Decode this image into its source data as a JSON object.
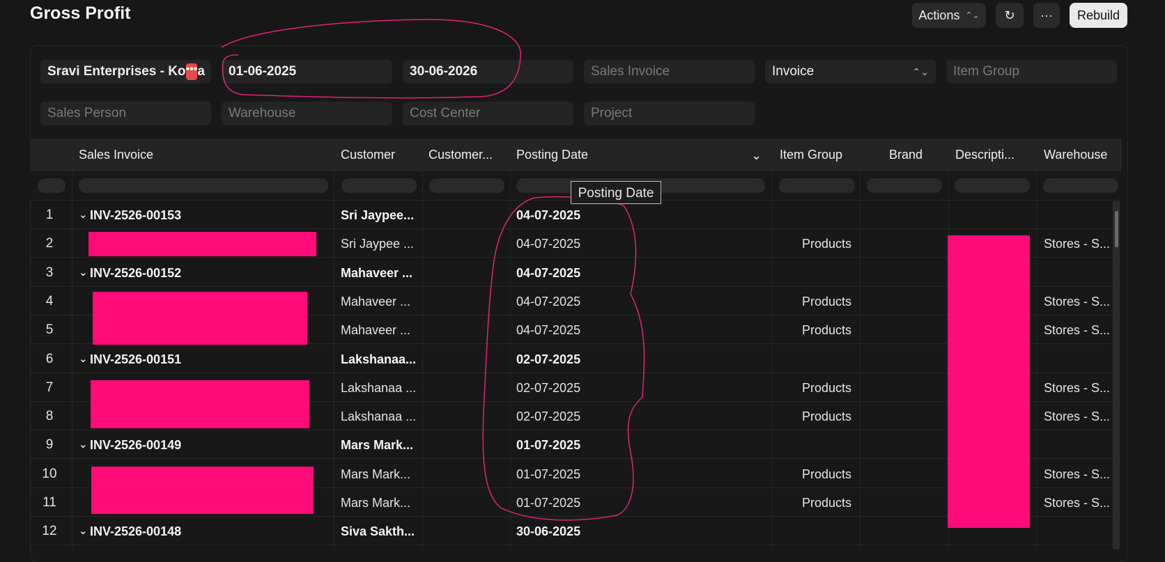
{
  "page": {
    "title": "Gross Profit"
  },
  "toolbar": {
    "actions_label": "Actions",
    "actions_arrow": "⌃⌄",
    "refresh_icon": "↻",
    "more_label": "···",
    "rebuild_label": "Rebuild"
  },
  "filters": {
    "company": "Sravi Enterprises - Ko",
    "company_tail": "a",
    "from_date": "01-06-2025",
    "to_date": "30-06-2026",
    "sales_invoice_placeholder": "Sales Invoice",
    "group_by": "Invoice",
    "item_group_placeholder": "Item Group",
    "sales_person_placeholder": "Sales Person",
    "warehouse_placeholder": "Warehouse",
    "cost_center_placeholder": "Cost Center",
    "project_placeholder": "Project"
  },
  "table": {
    "headers": {
      "sales_invoice": "Sales Invoice",
      "customer": "Customer",
      "customer_group": "Customer...",
      "posting_date": "Posting Date",
      "item_group": "Item Group",
      "brand": "Brand",
      "description": "Descripti...",
      "warehouse": "Warehouse"
    },
    "rows": [
      {
        "n": "1",
        "invoice": "INV-2526-00153",
        "customer": "Sri Jaypee...",
        "date": "04-07-2025",
        "item_group": "",
        "warehouse": ""
      },
      {
        "n": "2",
        "invoice": "",
        "customer": "Sri Jaypee ...",
        "date": "04-07-2025",
        "item_group": "Products",
        "warehouse": "Stores - S..."
      },
      {
        "n": "3",
        "invoice": "INV-2526-00152",
        "customer": "Mahaveer ...",
        "date": "04-07-2025",
        "item_group": "",
        "warehouse": ""
      },
      {
        "n": "4",
        "invoice": "",
        "customer": "Mahaveer ...",
        "date": "04-07-2025",
        "item_group": "Products",
        "warehouse": "Stores - S..."
      },
      {
        "n": "5",
        "invoice": "",
        "customer": "Mahaveer ...",
        "date": "04-07-2025",
        "item_group": "Products",
        "warehouse": "Stores - S..."
      },
      {
        "n": "6",
        "invoice": "INV-2526-00151",
        "customer": "Lakshanaa...",
        "date": "02-07-2025",
        "item_group": "",
        "warehouse": ""
      },
      {
        "n": "7",
        "invoice": "",
        "customer": "Lakshanaa ...",
        "date": "02-07-2025",
        "item_group": "Products",
        "warehouse": "Stores - S..."
      },
      {
        "n": "8",
        "invoice": "",
        "customer": "Lakshanaa ...",
        "date": "02-07-2025",
        "item_group": "Products",
        "warehouse": "Stores - S..."
      },
      {
        "n": "9",
        "invoice": "INV-2526-00149",
        "customer": "Mars Mark...",
        "date": "01-07-2025",
        "item_group": "",
        "warehouse": ""
      },
      {
        "n": "10",
        "invoice": "",
        "customer": "Mars Mark...",
        "date": "01-07-2025",
        "item_group": "Products",
        "warehouse": "Stores - S..."
      },
      {
        "n": "11",
        "invoice": "",
        "customer": "Mars Mark...",
        "date": "01-07-2025",
        "item_group": "Products",
        "warehouse": "Stores - S..."
      },
      {
        "n": "12",
        "invoice": "INV-2526-00148",
        "customer": "Siva Sakth...",
        "date": "30-06-2025",
        "item_group": "",
        "warehouse": ""
      }
    ]
  },
  "tooltip": {
    "text": "Posting Date"
  },
  "colors": {
    "background": "#171717",
    "panel": "#181818",
    "field": "#242424",
    "redaction": "#ff0a78",
    "annotation": "#e2237a"
  }
}
